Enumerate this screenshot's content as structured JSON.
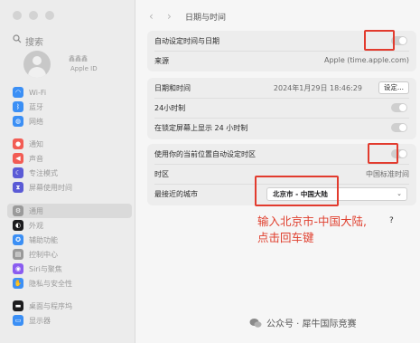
{
  "window": {
    "title": "日期与时间"
  },
  "sidebar": {
    "search_placeholder": "搜索",
    "account": {
      "name": "鑫鑫鑫",
      "sub": "Apple ID"
    },
    "items": [
      {
        "label": "Wi-Fi",
        "icon": "wifi-icon",
        "color": "#3b8ff5"
      },
      {
        "label": "蓝牙",
        "icon": "bluetooth-icon",
        "color": "#3b8ff5"
      },
      {
        "label": "网络",
        "icon": "globe-icon",
        "color": "#3b8ff5"
      },
      {
        "label": "通知",
        "icon": "bell-icon",
        "color": "#f25c54"
      },
      {
        "label": "声音",
        "icon": "speaker-icon",
        "color": "#f25c54"
      },
      {
        "label": "专注模式",
        "icon": "moon-icon",
        "color": "#5b5bd6"
      },
      {
        "label": "屏幕使用时间",
        "icon": "hourglass-icon",
        "color": "#5b5bd6"
      },
      {
        "label": "通用",
        "icon": "gear-icon",
        "color": "#9a9a9a",
        "selected": true
      },
      {
        "label": "外观",
        "icon": "appearance-icon",
        "color": "#1d1d1f"
      },
      {
        "label": "辅助功能",
        "icon": "accessibility-icon",
        "color": "#3b8ff5"
      },
      {
        "label": "控制中心",
        "icon": "control-center-icon",
        "color": "#9a9a9a"
      },
      {
        "label": "Siri与聚焦",
        "icon": "siri-icon",
        "color": "#8a5cf0"
      },
      {
        "label": "隐私与安全性",
        "icon": "hand-icon",
        "color": "#3b8ff5"
      },
      {
        "label": "桌面与程序坞",
        "icon": "dock-icon",
        "color": "#1d1d1f"
      },
      {
        "label": "显示器",
        "icon": "display-icon",
        "color": "#3b8ff5"
      }
    ]
  },
  "nav": {
    "back": "‹",
    "forward": "›"
  },
  "card1": {
    "auto_label": "自动设定时间与日期",
    "source_label": "来源",
    "source_value": "Apple (time.apple.com)"
  },
  "card2": {
    "datetime_label": "日期和时间",
    "datetime_value": "2024年1月29日 18:46:29",
    "set_button": "设定...",
    "h24_label": "24小时制",
    "lock_label": "在锁定屏幕上显示 24 小时制"
  },
  "card3": {
    "location_label": "使用你的当前位置自动设定时区",
    "tz_label": "时区",
    "tz_value": "中国标准时间",
    "city_label": "最接近的城市",
    "city_value": "北京市 - 中国大陆",
    "city_chevron": "⌄"
  },
  "annotation": {
    "line1": "输入北京市-中国大陆,",
    "line2": "点击回车键",
    "question_mark": "?"
  },
  "watermark": {
    "text": "公众号 · 犀牛国际竞赛"
  },
  "colors": {
    "highlight": "#e23b2e",
    "annotation": "#e0402f"
  }
}
